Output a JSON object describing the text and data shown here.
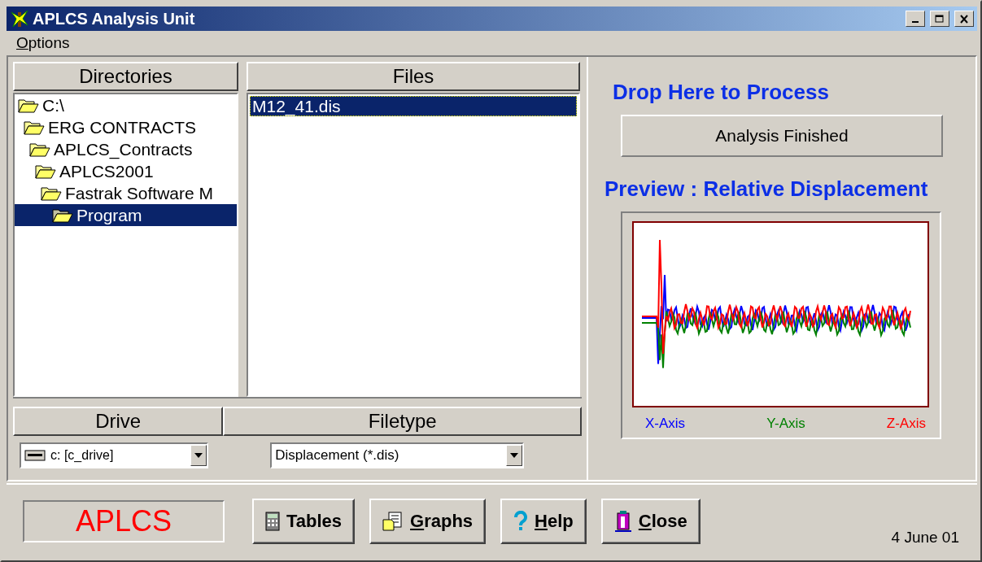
{
  "window": {
    "title": "APLCS Analysis Unit"
  },
  "menu": [
    {
      "label": "Options",
      "underlined_mnemonic": true
    }
  ],
  "directories": {
    "header": "Directories",
    "tree": [
      {
        "label": "C:\\",
        "selected": false,
        "children": [
          {
            "label": "ERG CONTRACTS",
            "selected": false,
            "children": [
              {
                "label": "APLCS_Contracts",
                "selected": false,
                "children": [
                  {
                    "label": "APLCS2001",
                    "selected": false,
                    "children": [
                      {
                        "label": "Fastrak Software M",
                        "selected": false,
                        "children": [
                          {
                            "label": "Program",
                            "selected": true
                          }
                        ]
                      }
                    ]
                  }
                ]
              }
            ]
          }
        ]
      }
    ]
  },
  "files": {
    "header": "Files",
    "items": [
      {
        "label": "M12_41.dis",
        "selected": true
      }
    ]
  },
  "drive": {
    "header": "Drive",
    "value": "c: [c_drive]"
  },
  "filetype": {
    "header": "Filetype",
    "value": "Displacement (*.dis)"
  },
  "drop_title": "Drop Here to Process",
  "status": "Analysis Finished",
  "preview_title": "Preview : Relative Displacement",
  "legend": [
    {
      "label": "X-Axis",
      "color": "#0000ff"
    },
    {
      "label": "Y-Axis",
      "color": "#008000"
    },
    {
      "label": "Z-Axis",
      "color": "#ff0000"
    }
  ],
  "logo": "APLCS",
  "buttons": [
    {
      "label": "Tables",
      "kind": "calculator",
      "underlined_mnemonic": false
    },
    {
      "label": "Graphs",
      "kind": "document",
      "underlined_mnemonic": true
    },
    {
      "label": "Help",
      "kind": "question",
      "underlined_mnemonic": true
    },
    {
      "label": "Close",
      "kind": "door",
      "underlined_mnemonic": true
    }
  ],
  "date": "4 June 01"
}
